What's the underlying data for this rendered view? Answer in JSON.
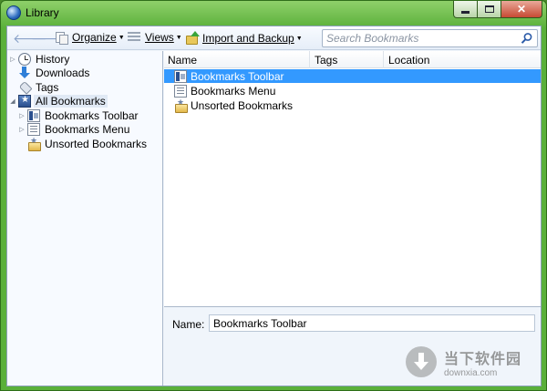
{
  "window": {
    "title": "Library"
  },
  "toolbar": {
    "organize_label": "Organize",
    "views_label": "Views",
    "import_label": "Import and Backup",
    "search_placeholder": "Search Bookmarks",
    "search_value": ""
  },
  "sidebar": {
    "items": [
      {
        "label": "History",
        "icon": "history-icon",
        "twisty": "▷"
      },
      {
        "label": "Downloads",
        "icon": "downloads-icon",
        "twisty": ""
      },
      {
        "label": "Tags",
        "icon": "tags-icon",
        "twisty": ""
      },
      {
        "label": "All Bookmarks",
        "icon": "all-bookmarks-icon",
        "twisty": "◢"
      },
      {
        "label": "Bookmarks Toolbar",
        "icon": "bookmarks-toolbar-icon",
        "twisty": "▷"
      },
      {
        "label": "Bookmarks Menu",
        "icon": "bookmarks-menu-icon",
        "twisty": "▷"
      },
      {
        "label": "Unsorted Bookmarks",
        "icon": "unsorted-bookmarks-icon",
        "twisty": ""
      }
    ]
  },
  "columns": [
    "Name",
    "Tags",
    "Location"
  ],
  "list": {
    "rows": [
      {
        "name": "Bookmarks Toolbar",
        "icon": "bookmarks-toolbar-icon"
      },
      {
        "name": "Bookmarks Menu",
        "icon": "bookmarks-menu-icon"
      },
      {
        "name": "Unsorted Bookmarks",
        "icon": "unsorted-bookmarks-icon"
      }
    ]
  },
  "details": {
    "name_label": "Name:",
    "name_value": "Bookmarks Toolbar"
  },
  "watermark": {
    "site_name": "当下软件园",
    "url": "downxia.com"
  },
  "colors": {
    "selection": "#3399ff",
    "frame": "#5ab03a",
    "pane": "#f0f5fb"
  }
}
